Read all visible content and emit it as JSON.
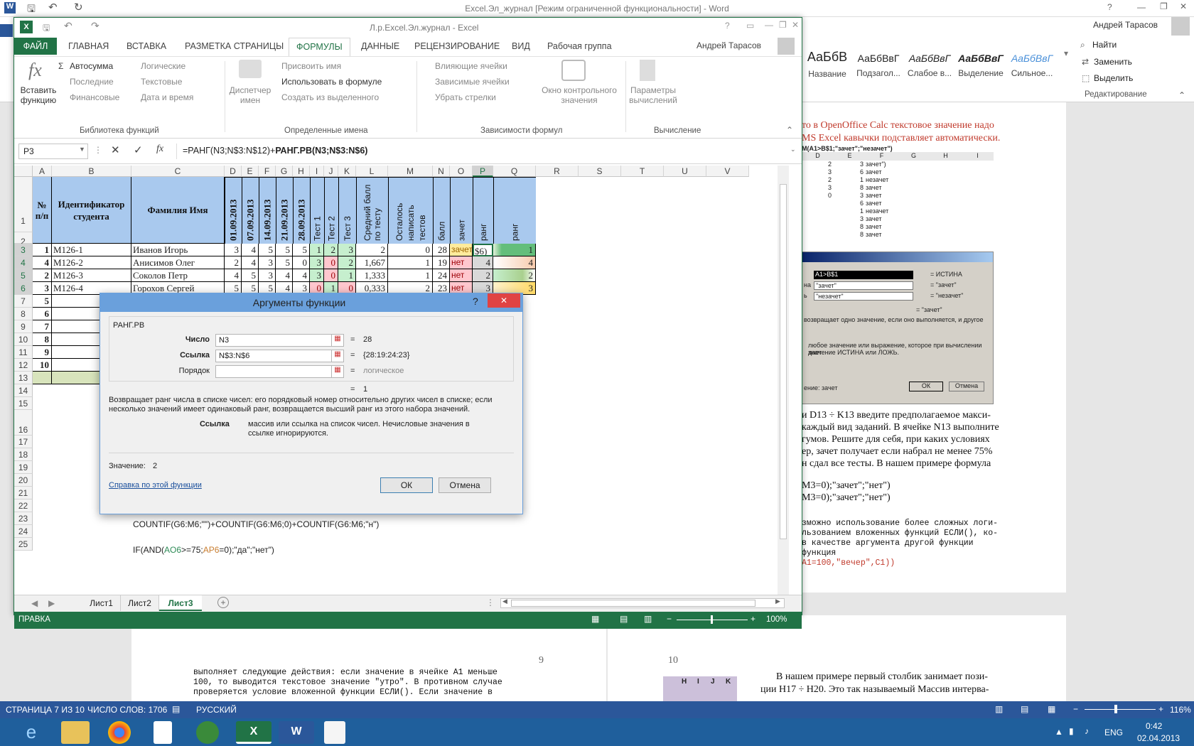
{
  "word": {
    "title": "Excel.Эл_журнал [Режим ограниченной функциональности] - Word",
    "user": "Андрей Тарасов",
    "styles": [
      {
        "sample": "АаБбВ",
        "name": "Название"
      },
      {
        "sample": "АаБбВвГ",
        "name": "Подзагол..."
      },
      {
        "sample": "АаБбВвГ",
        "name": "Слабое в..."
      },
      {
        "sample": "АаБбВвГ",
        "name": "Выделение"
      },
      {
        "sample": "АаБбВвГ",
        "name": "Сильное..."
      }
    ],
    "editing": {
      "find": "Найти",
      "replace": "Заменить",
      "select": "Выделить",
      "group": "Редактирование"
    },
    "doc_right_text": [
      "то в OpenOffice Calc текстовое значение надо",
      "MS Excel кавычки подставляет автоматически.",
      "и D13 ÷ K13 введите предполагаемое макси-",
      "каждый вид заданий. В ячейке N13 выполните",
      "гумов.  Решите для себя, при каких условиях",
      "ер, зачет получает если набрал не менее 75%",
      "н сдал все тесты. В нашем примере формула",
      "M3=0);\"зачет\";\"нет\")",
      "M3=0);\"зачет\";\"нет\")",
      "зможно использование более сложных логи-",
      "льзованием вложенных функций ЕСЛИ(), ко-",
      "в качестве аргумента другой функции",
      "функция",
      "A1=100,\"вечер\",C1))"
    ],
    "page9_num": "9",
    "page10_num": "10",
    "page9_lines": [
      "выполняет следующие действия: если значение в ячейке A1 меньше",
      "100, то выводится текстовое значение \"утро\". В противном случае",
      "проверяется условие вложенной функции ЕСЛИ(). Если значение в"
    ],
    "page10_lines": [
      "В нашем примере первый столбик занимает пози-",
      "ции H17 ÷ H20. Это так называемый Массив интерва-"
    ],
    "page10_tbl": [
      "H",
      "I",
      "J",
      "K"
    ],
    "status": {
      "page": "СТРАНИЦА 7 ИЗ 10",
      "words": "ЧИСЛО СЛОВ: 1706",
      "lang": "РУССКИЙ",
      "zoom": "116%"
    },
    "tray": {
      "lang": "ENG",
      "time": "0:42",
      "date": "02.04.2013"
    },
    "embed_header": "М(A1>B$1;\"зачет\";\"незачет\")",
    "embed_cols": [
      "D",
      "E",
      "F",
      "G",
      "H",
      "I"
    ],
    "embed_rows": [
      [
        "2",
        "3",
        "зачет\")"
      ],
      [
        "3",
        "6",
        "зачет"
      ],
      [
        "2",
        "1",
        "незачет"
      ],
      [
        "3",
        "8",
        "зачет"
      ],
      [
        "0",
        "3",
        "зачет"
      ],
      [
        "",
        "6",
        "зачет"
      ],
      [
        "",
        "1",
        "незачет"
      ],
      [
        "",
        "3",
        "зачет"
      ],
      [
        "",
        "8",
        "зачет"
      ],
      [
        "",
        "8",
        "зачет"
      ]
    ],
    "embed_dlg": {
      "f1": "A1>B$1",
      "r1": "= ИСТИНА",
      "p2": "на",
      "f2": "\"зачет\"",
      "r2": "= \"зачет\"",
      "p3": "ь",
      "f3": "\"незачет\"",
      "r3": "= \"незачет\"",
      "res": "= \"зачет\"",
      "d1": "возвращает одно значение, если оно выполняется, и другое",
      "d2": "любое значение или выражение, которое при вычислении дает",
      "d3": "значение ИСТИНА или ЛОЖЬ.",
      "val": "ение: зачет",
      "ok": "ОК",
      "cancel": "Отмена"
    }
  },
  "excel": {
    "title": "Л.р.Excel.Эл.журнал - Excel",
    "user": "Андрей Тарасов",
    "tabs": [
      "ФАЙЛ",
      "ГЛАВНАЯ",
      "ВСТАВКА",
      "РАЗМЕТКА СТРАНИЦЫ",
      "ФОРМУЛЫ",
      "ДАННЫЕ",
      "РЕЦЕНЗИРОВАНИЕ",
      "ВИД",
      "Рабочая группа"
    ],
    "ribbon": {
      "insert_fn": "Вставить функцию",
      "autosum": "Автосумма",
      "recent": "Последние",
      "financial": "Финансовые",
      "logical": "Логические",
      "text": "Текстовые",
      "datetime": "Дата и время",
      "grp_lib": "Библиотека функций",
      "name_mgr": "Диспетчер имен",
      "assign": "Присвоить имя",
      "use_in": "Использовать в формуле",
      "create": "Создать из выделенного",
      "grp_names": "Определенные имена",
      "prec": "Влияющие ячейки",
      "dep": "Зависимые ячейки",
      "remove": "Убрать стрелки",
      "watch": "Окно контрольного значения",
      "grp_audit": "Зависимости формул",
      "calcopt": "Параметры вычислений",
      "grp_calc": "Вычисление"
    },
    "namebox": "P3",
    "formula_a": "=РАНГ(N3;N$3:N$12)+",
    "formula_b": "РАНГ.РВ(N3;N$3:N$6)",
    "columns": [
      "A",
      "B",
      "C",
      "D",
      "E",
      "F",
      "G",
      "H",
      "I",
      "J",
      "K",
      "L",
      "M",
      "N",
      "O",
      "P",
      "Q",
      "R",
      "S",
      "T",
      "U",
      "V"
    ],
    "headers": {
      "a": "№ п/п",
      "b": "Идентификатор студента",
      "c": "Фамилия Имя",
      "dates": [
        "01.09.2013",
        "07.09.2013",
        "14.09.2013",
        "21.09.2013",
        "28.09.2013"
      ],
      "t1": "Тест 1",
      "t2": "Тест 2",
      "t3": "Тест 3",
      "l": "Средний балл по тесту",
      "m": "Осталось написать тестов",
      "n": "балл",
      "o": "зачет",
      "p": "ранг",
      "q": "ранг"
    },
    "rows": [
      {
        "r": "3",
        "a": "1",
        "b": "М126-1",
        "c": "Иванов Игорь",
        "d": [
          "3",
          "4",
          "5",
          "5",
          "5"
        ],
        "t": [
          "1",
          "2",
          "3"
        ],
        "l": "2",
        "m": "0",
        "n": "28",
        "o": "зачет",
        "p": "$6)",
        "q": "1"
      },
      {
        "r": "4",
        "a": "4",
        "b": "М126-2",
        "c": "Анисимов Олег",
        "d": [
          "2",
          "4",
          "3",
          "5",
          "0"
        ],
        "t": [
          "3",
          "0",
          "2"
        ],
        "l": "1,667",
        "m": "1",
        "n": "19",
        "o": "нет",
        "p": "4",
        "q": "4"
      },
      {
        "r": "5",
        "a": "2",
        "b": "М126-3",
        "c": "Соколов Петр",
        "d": [
          "4",
          "5",
          "3",
          "4",
          "4"
        ],
        "t": [
          "3",
          "0",
          "1"
        ],
        "l": "1,333",
        "m": "1",
        "n": "24",
        "o": "нет",
        "p": "2",
        "q": "2"
      },
      {
        "r": "6",
        "a": "3",
        "b": "М126-4",
        "c": "Горохов Сергей",
        "d": [
          "5",
          "5",
          "5",
          "4",
          "3"
        ],
        "t": [
          "0",
          "1",
          "0"
        ],
        "l": "0,333",
        "m": "2",
        "n": "23",
        "o": "нет",
        "p": "3",
        "q": "3"
      }
    ],
    "rownums": [
      "1",
      "2",
      "3",
      "4",
      "5",
      "6",
      "7",
      "8",
      "9",
      "10",
      "11",
      "12",
      "13",
      "14",
      "15",
      "16",
      "17",
      "18",
      "19",
      "20",
      "21",
      "22",
      "23",
      "24",
      "25"
    ],
    "a_extra": [
      "5",
      "6",
      "7",
      "8",
      "9",
      "10"
    ],
    "cell_c23": "COUNTIF(G6:M6;\"\")+COUNTIF(G6:M6;0)+COUNTIF(G6:M6;\"н\")",
    "cell_c25_a": "IF(AND(",
    "cell_c25_b": "AO6",
    "cell_c25_c": ">=75;",
    "cell_c25_d": "AP6",
    "cell_c25_e": "=0);\"да\";\"нет\")",
    "sheets": [
      "Лист1",
      "Лист2",
      "Лист3"
    ],
    "status": "ПРАВКА",
    "zoom": "100%"
  },
  "dialog": {
    "title": "Аргументы функции",
    "fn": "РАНГ.РВ",
    "arg1_label": "Число",
    "arg1_value": "N3",
    "arg1_result": "28",
    "arg2_label": "Ссылка",
    "arg2_value": "N$3:N$6",
    "arg2_result": "{28:19:24:23}",
    "arg3_label": "Порядок",
    "arg3_value": "",
    "arg3_result": "логическое",
    "result": "1",
    "desc": "Возвращает ранг числа в списке чисел: его порядковый номер относительно других чисел в списке; если несколько значений имеет одинаковый ранг, возвращается высший ранг из этого набора значений.",
    "arg_help_name": "Ссылка",
    "arg_help": "массив или ссылка на список чисел. Нечисловые значения в ссылке игнорируются.",
    "value_label": "Значение:",
    "value": "2",
    "help_link": "Справка по этой функции",
    "ok": "ОК",
    "cancel": "Отмена"
  }
}
